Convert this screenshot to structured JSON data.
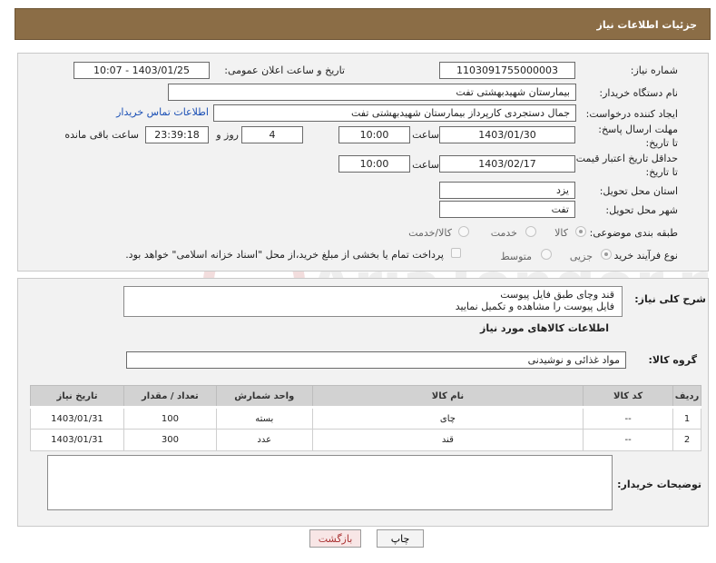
{
  "title": "جزئیات اطلاعات نیاز",
  "need_number": {
    "label": "شماره نیاز:",
    "value": "1103091755000003"
  },
  "announce_datetime": {
    "label": "تاریخ و ساعت اعلان عمومی:",
    "value": "1403/01/25 - 10:07"
  },
  "buyer_org": {
    "label": "نام دستگاه خریدار:",
    "value": "بیمارستان شهیدبهشتی تفت"
  },
  "requester": {
    "label": "ایجاد کننده درخواست:",
    "value": "جمال  دستجردی کارپرداز بیمارستان شهیدبهشتی تفت",
    "contact_link": "اطلاعات تماس خریدار"
  },
  "reply_deadline": {
    "label": "مهلت ارسال پاسخ: تا تاریخ:",
    "date": "1403/01/30",
    "time_label": "ساعت",
    "time": "10:00",
    "days": "4",
    "days_label": "روز و",
    "remaining": "23:39:18",
    "remaining_label": "ساعت باقی مانده"
  },
  "price_validity": {
    "label": "حداقل تاریخ اعتبار قیمت: تا تاریخ:",
    "date": "1403/02/17",
    "time_label": "ساعت",
    "time": "10:00"
  },
  "province": {
    "label": "استان محل تحویل:",
    "value": "یزد"
  },
  "city": {
    "label": "شهر محل تحویل:",
    "value": "تفت"
  },
  "category": {
    "label": "طبقه بندی موضوعی:",
    "options": [
      "کالا",
      "خدمت",
      "کالا/خدمت"
    ],
    "selected": "کالا"
  },
  "process_type": {
    "label": "نوع فرآیند خرید :",
    "options": [
      "جزیی",
      "متوسط"
    ],
    "selected": "جزیی",
    "note": "پرداخت تمام یا بخشی از مبلغ خرید،از محل \"اسناد خزانه اسلامی\" خواهد بود."
  },
  "description": {
    "label": "شرح کلی نیاز:",
    "value": "قند وچای طبق فایل پیوست\nفایل پیوست را مشاهده و تکمیل نمایید"
  },
  "goods_info_title": "اطلاعات کالاهای مورد نیاز",
  "goods_group": {
    "label": "گروه کالا:",
    "value": "مواد غذائی و نوشیدنی"
  },
  "table": {
    "headers": [
      "ردیف",
      "کد کالا",
      "نام کالا",
      "واحد شمارش",
      "تعداد / مقدار",
      "تاریخ نیاز"
    ],
    "rows": [
      [
        "1",
        "--",
        "چای",
        "بسته",
        "100",
        "1403/01/31"
      ],
      [
        "2",
        "--",
        "قند",
        "عدد",
        "300",
        "1403/01/31"
      ]
    ]
  },
  "buyer_notes": {
    "label": "توضیحات خریدار:",
    "value": ""
  },
  "buttons": {
    "print": "چاپ",
    "back": "بازگشت"
  },
  "watermark_text": "AriaTender.neT"
}
